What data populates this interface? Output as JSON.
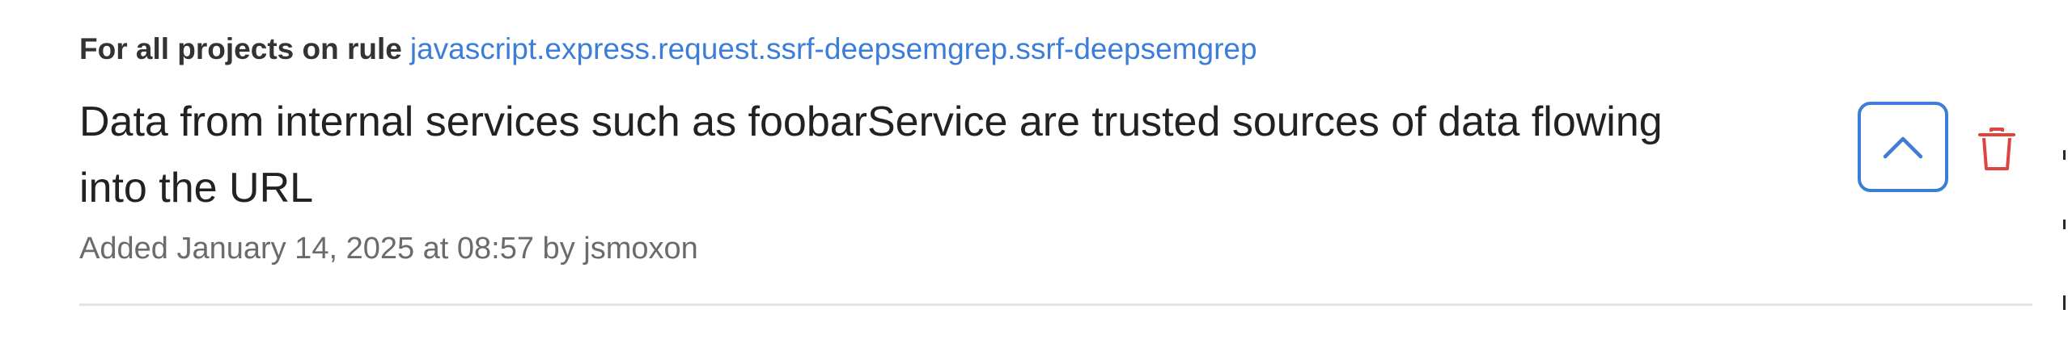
{
  "memory": {
    "scope_prefix": "For all projects on rule",
    "rule_id": "javascript.express.request.ssrf-deepsemgrep.ssrf-deepsemgrep",
    "text": "Data from internal services such as foobarService are trusted sources of data flowing into the URL",
    "meta": "Added January 14, 2025 at 08:57 by jsmoxon"
  },
  "icons": {
    "collapse": "chevron-up-icon",
    "delete": "trash-icon"
  },
  "colors": {
    "accent": "#3b7dd8",
    "danger": "#e0443e",
    "text": "#222222",
    "muted": "#6b6b6b",
    "divider": "#e4e4e4"
  }
}
